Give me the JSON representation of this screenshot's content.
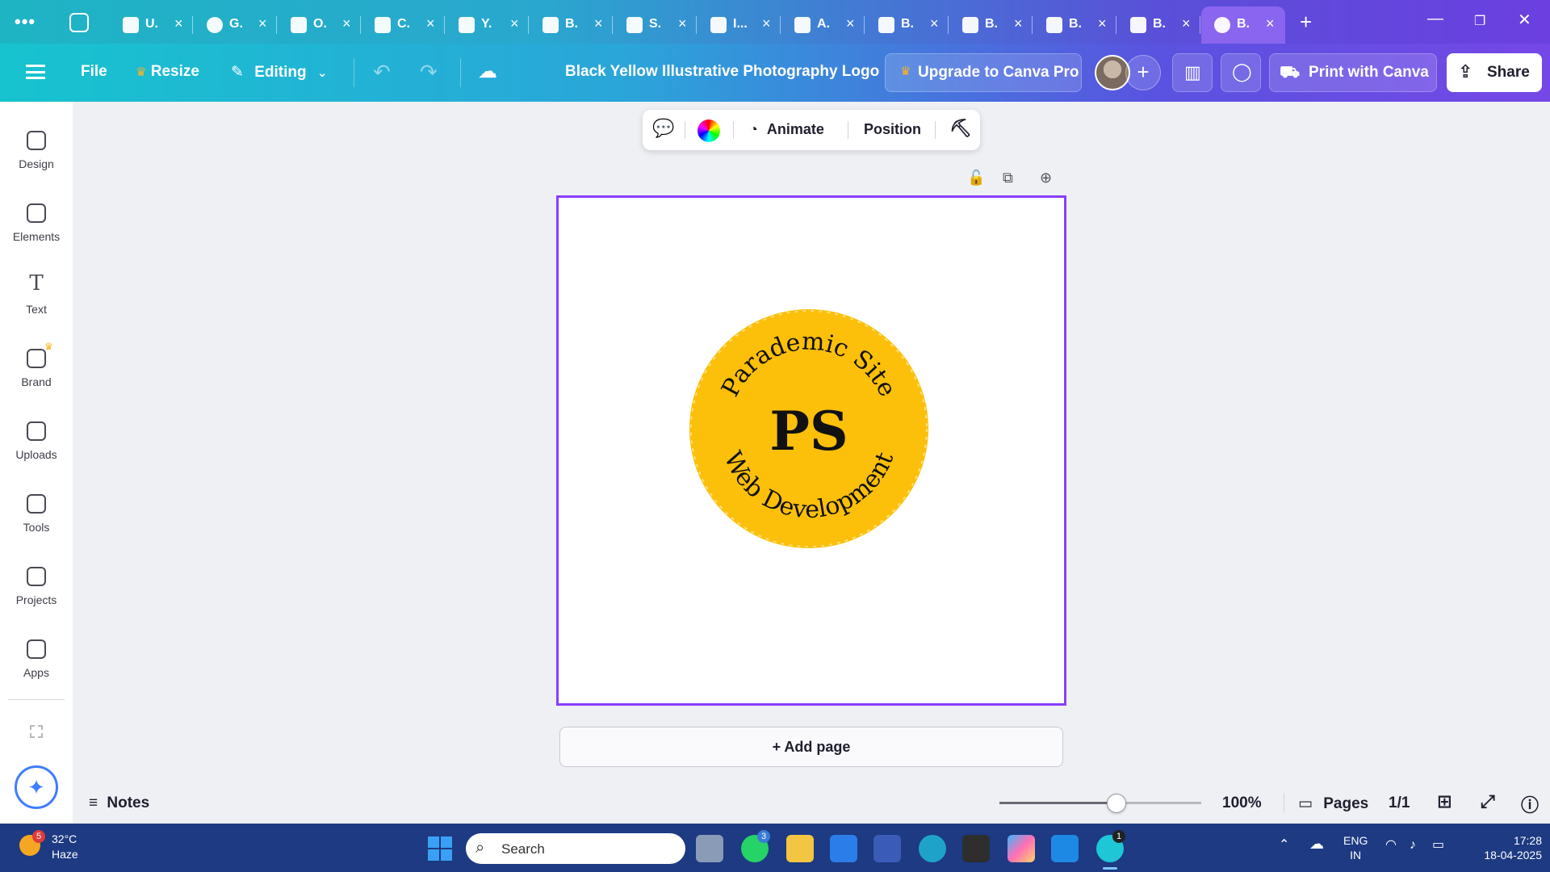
{
  "browser": {
    "tabs": [
      {
        "label": "U.",
        "icon": "app-icon"
      },
      {
        "label": "G.",
        "icon": "canva-icon"
      },
      {
        "label": "O.",
        "icon": "heart-chat-icon"
      },
      {
        "label": "C.",
        "icon": "heart-chat-icon"
      },
      {
        "label": "Y.",
        "icon": "heart-chat-icon"
      },
      {
        "label": "B.",
        "icon": "print-icon"
      },
      {
        "label": "S.",
        "icon": "document-icon"
      },
      {
        "label": "I...",
        "icon": "document-icon"
      },
      {
        "label": "A.",
        "icon": "video-icon"
      },
      {
        "label": "B.",
        "icon": "video-icon"
      },
      {
        "label": "B.",
        "icon": "heart-chat-icon"
      },
      {
        "label": "B.",
        "icon": "print-icon"
      },
      {
        "label": "B.",
        "icon": "print-icon"
      },
      {
        "label": "B.",
        "icon": "canva-icon"
      }
    ],
    "close_glyph": "×",
    "new_tab_glyph": "+"
  },
  "header": {
    "file_label": "File",
    "resize_label": "Resize",
    "editing_label": "Editing",
    "design_title": "Black Yellow Illustrative Photography Logo",
    "upgrade_label": "Upgrade to Canva Pro",
    "print_label": "Print with Canva",
    "share_label": "Share",
    "crown_color": "#ffb31a"
  },
  "sidebar": {
    "items": [
      {
        "label": "Design",
        "icon": "layout-icon"
      },
      {
        "label": "Elements",
        "icon": "shapes-icon"
      },
      {
        "label": "Text",
        "icon": "text-icon"
      },
      {
        "label": "Brand",
        "icon": "brand-icon"
      },
      {
        "label": "Uploads",
        "icon": "cloud-upload-icon"
      },
      {
        "label": "Tools",
        "icon": "pen-icon"
      },
      {
        "label": "Projects",
        "icon": "folder-icon"
      },
      {
        "label": "Apps",
        "icon": "apps-grid-icon"
      }
    ]
  },
  "toolbar": {
    "animate_label": "Animate",
    "position_label": "Position"
  },
  "canvas": {
    "logo": {
      "top_text": "Parademic Site",
      "bottom_text": "Web Development",
      "monogram": "PS",
      "fill_color": "#fcbf0a"
    },
    "add_page_label": "+  Add page",
    "border_color": "#8b3dff"
  },
  "footer": {
    "notes_label": "Notes",
    "zoom_label": "100%",
    "zoom_fraction": 0.58,
    "pages_label": "Pages",
    "page_count": "1/1"
  },
  "taskbar": {
    "temperature": "32°C",
    "weather": "Haze",
    "weather_badge": "5",
    "search_placeholder": "Search",
    "whatsapp_badge": "3",
    "canva_badge": "1",
    "lang_line1": "ENG",
    "lang_line2": "IN",
    "time": "17:28",
    "date": "18-04-2025"
  }
}
